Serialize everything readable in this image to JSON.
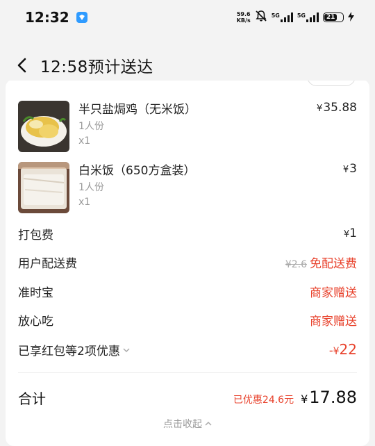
{
  "status_bar": {
    "time": "12:32",
    "net_speed_value": "59.6",
    "net_speed_unit": "KB/s",
    "signal1_label": "5G",
    "signal2_label": "5G",
    "battery": "21"
  },
  "header": {
    "title": "12:58预计送达"
  },
  "items": [
    {
      "name": "半只盐焗鸡（无米饭）",
      "portion": "1人份",
      "qty": "x1",
      "price": "35.88"
    },
    {
      "name": "白米饭（650方盒装）",
      "portion": "1人份",
      "qty": "x1",
      "price": "3"
    }
  ],
  "fees": {
    "packing_label": "打包费",
    "packing_value": "1",
    "delivery_label": "用户配送费",
    "delivery_original": "¥2.6",
    "delivery_value": "免配送费",
    "ontime_label": "准时宝",
    "ontime_value": "商家赠送",
    "safe_label": "放心吃",
    "safe_value": "商家赠送",
    "promo_label": "已享红包等2项优惠",
    "promo_value": "22"
  },
  "total": {
    "label": "合计",
    "saved": "已优惠24.6元",
    "amount": "17.88"
  },
  "collapse_label": "点击收起",
  "currency_symbol": "¥",
  "colors": {
    "accent_red": "#e8422c",
    "background": "#f3f3f3",
    "card": "#ffffff"
  }
}
